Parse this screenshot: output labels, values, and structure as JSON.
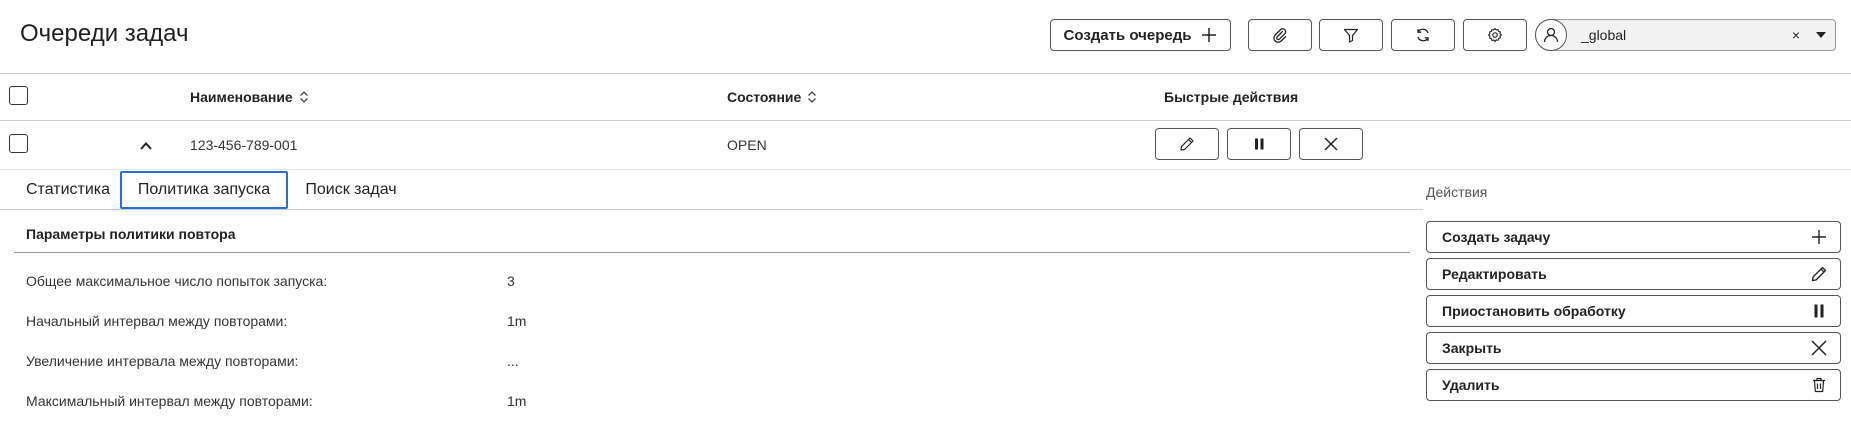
{
  "header": {
    "title": "Очереди задач",
    "create_queue_label": "Создать очередь",
    "namespace_value": "_global",
    "namespace_clear": "×"
  },
  "table": {
    "columns": {
      "name": "Наименование",
      "state": "Состояние",
      "quick_actions": "Быстрые действия"
    },
    "rows": [
      {
        "name": "123-456-789-001",
        "state": "OPEN"
      }
    ]
  },
  "tabs": [
    {
      "label": "Статистика",
      "active": false
    },
    {
      "label": "Политика запуска",
      "active": true
    },
    {
      "label": "Поиск задач",
      "active": false
    }
  ],
  "policy": {
    "section_title": "Параметры политики повтора",
    "params": [
      {
        "label": "Общее максимальное число попыток запуска:",
        "value": "3"
      },
      {
        "label": "Начальный интервал между повторами:",
        "value": "1m"
      },
      {
        "label": "Увеличение интервала между повторами:",
        "value": "..."
      },
      {
        "label": "Максимальный интервал между повторами:",
        "value": "1m"
      }
    ]
  },
  "actions": {
    "title": "Действия",
    "items": [
      {
        "label": "Создать задачу",
        "icon": "plus-icon"
      },
      {
        "label": "Редактировать",
        "icon": "pencil-icon"
      },
      {
        "label": "Приостановить обработку",
        "icon": "pause-icon"
      },
      {
        "label": "Закрыть",
        "icon": "close-icon"
      },
      {
        "label": "Удалить",
        "icon": "trash-icon"
      }
    ]
  }
}
